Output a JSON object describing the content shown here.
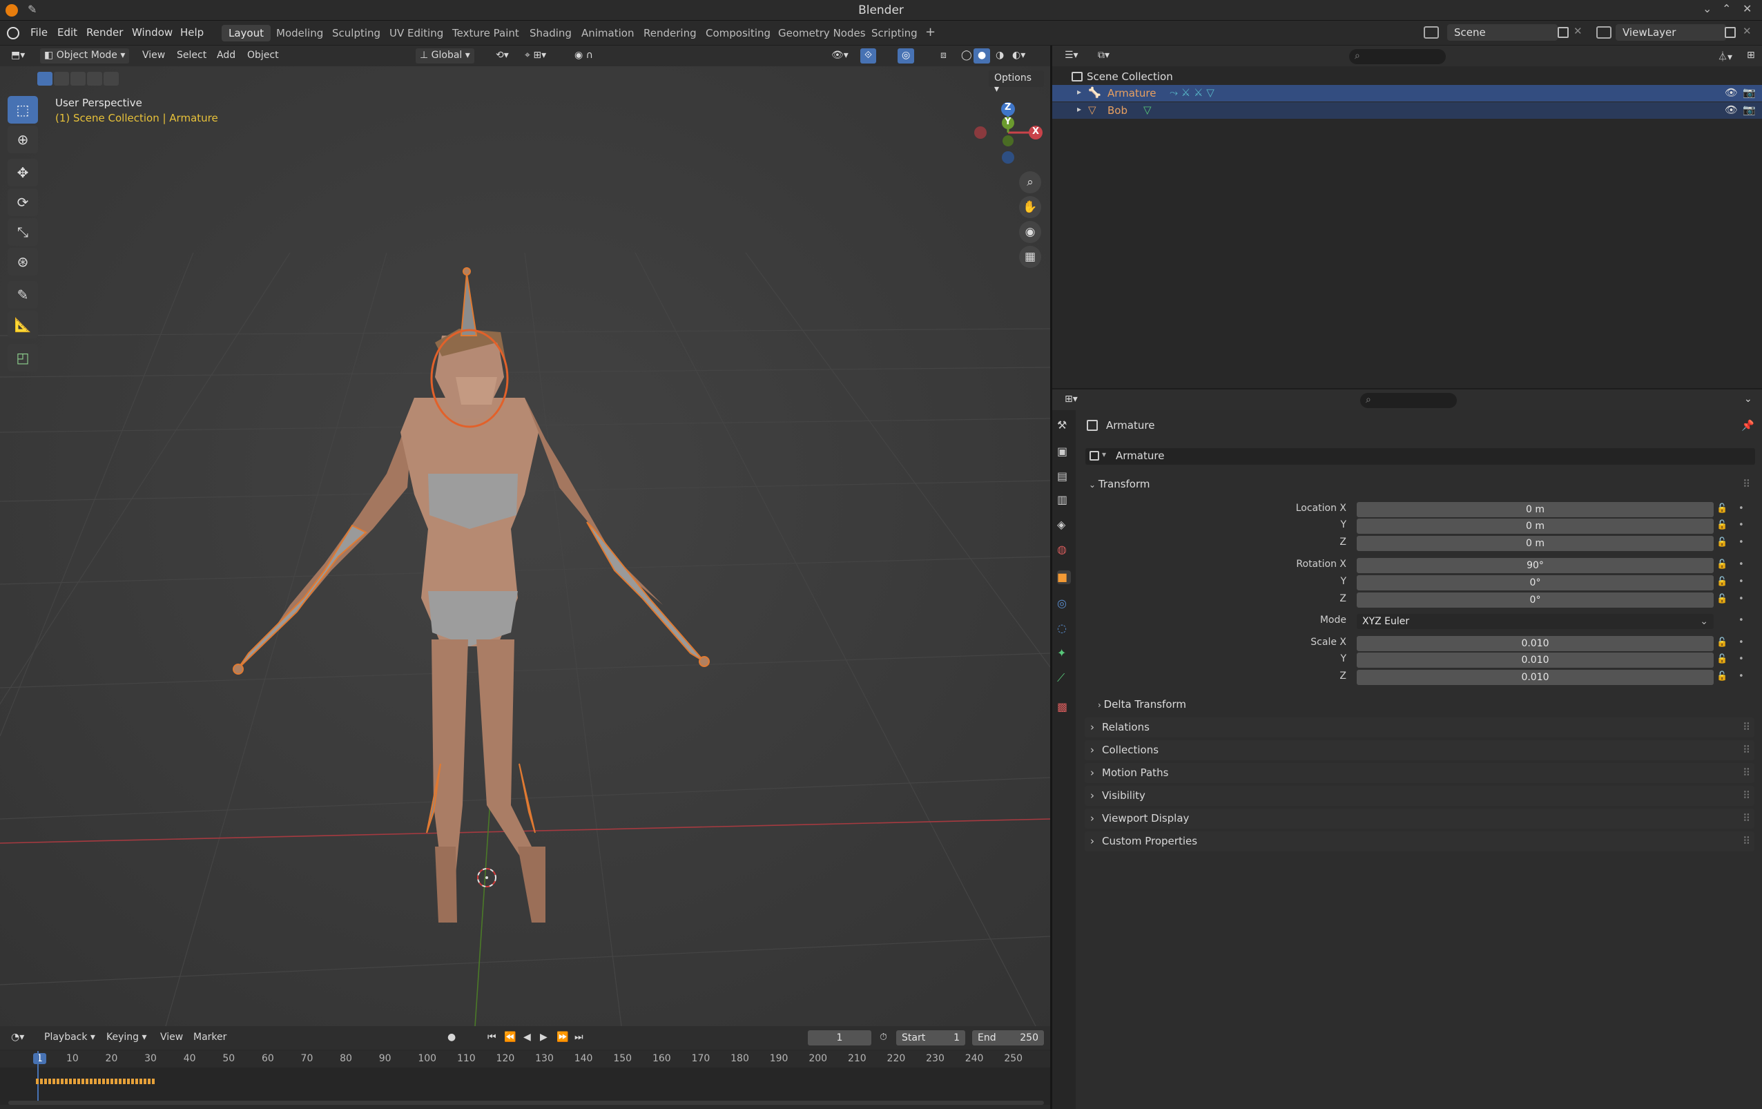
{
  "window": {
    "title": "Blender"
  },
  "menu": {
    "items": [
      "File",
      "Edit",
      "Render",
      "Window",
      "Help"
    ]
  },
  "workspaces": [
    "Layout",
    "Modeling",
    "Sculpting",
    "UV Editing",
    "Texture Paint",
    "Shading",
    "Animation",
    "Rendering",
    "Compositing",
    "Geometry Nodes",
    "Scripting"
  ],
  "active_workspace": "Layout",
  "top_right": {
    "scene": "Scene",
    "view_layer": "ViewLayer"
  },
  "viewport": {
    "mode": "Object Mode",
    "menus": [
      "View",
      "Select",
      "Add",
      "Object"
    ],
    "transform_orientation": "Global",
    "options_label": "Options",
    "overlay_title": "User Perspective",
    "overlay_subtitle": "(1) Scene Collection | Armature",
    "gizmo_labels": {
      "z": "Z",
      "y": "Y",
      "x": "X"
    }
  },
  "outliner": {
    "root": "Scene Collection",
    "items": [
      {
        "name": "Armature",
        "selected": true,
        "color": "#e8a060"
      },
      {
        "name": "Bob",
        "selected": false,
        "color": "#e8a060"
      }
    ]
  },
  "properties": {
    "object_name": "Armature",
    "data_name": "Armature",
    "transform_header": "Transform",
    "location": {
      "label": "Location X",
      "x": "0 m",
      "y": "0 m",
      "z": "0 m"
    },
    "rotation": {
      "label": "Rotation X",
      "x": "90°",
      "y": "0°",
      "z": "0°"
    },
    "mode_label": "Mode",
    "mode_value": "XYZ Euler",
    "scale": {
      "label": "Scale X",
      "x": "0.010",
      "y": "0.010",
      "z": "0.010"
    },
    "axis_y": "Y",
    "axis_z": "Z",
    "delta_transform": "Delta Transform",
    "panels": [
      "Relations",
      "Collections",
      "Motion Paths",
      "Visibility",
      "Viewport Display",
      "Custom Properties"
    ]
  },
  "timeline": {
    "menus": [
      "Playback",
      "Keying",
      "View",
      "Marker"
    ],
    "current_frame": "1",
    "start_label": "Start",
    "start_value": "1",
    "end_label": "End",
    "end_value": "250",
    "ruler": [
      "1",
      "10",
      "20",
      "30",
      "40",
      "50",
      "60",
      "70",
      "80",
      "90",
      "100",
      "110",
      "120",
      "130",
      "140",
      "150",
      "160",
      "170",
      "180",
      "190",
      "200",
      "210",
      "220",
      "230",
      "240",
      "250"
    ]
  },
  "colors": {
    "accent": "#4772b3",
    "active_text": "#e8a060",
    "x_axis": "#c9434a",
    "y_axis": "#6b9b2e",
    "z_axis": "#3f76c9"
  }
}
